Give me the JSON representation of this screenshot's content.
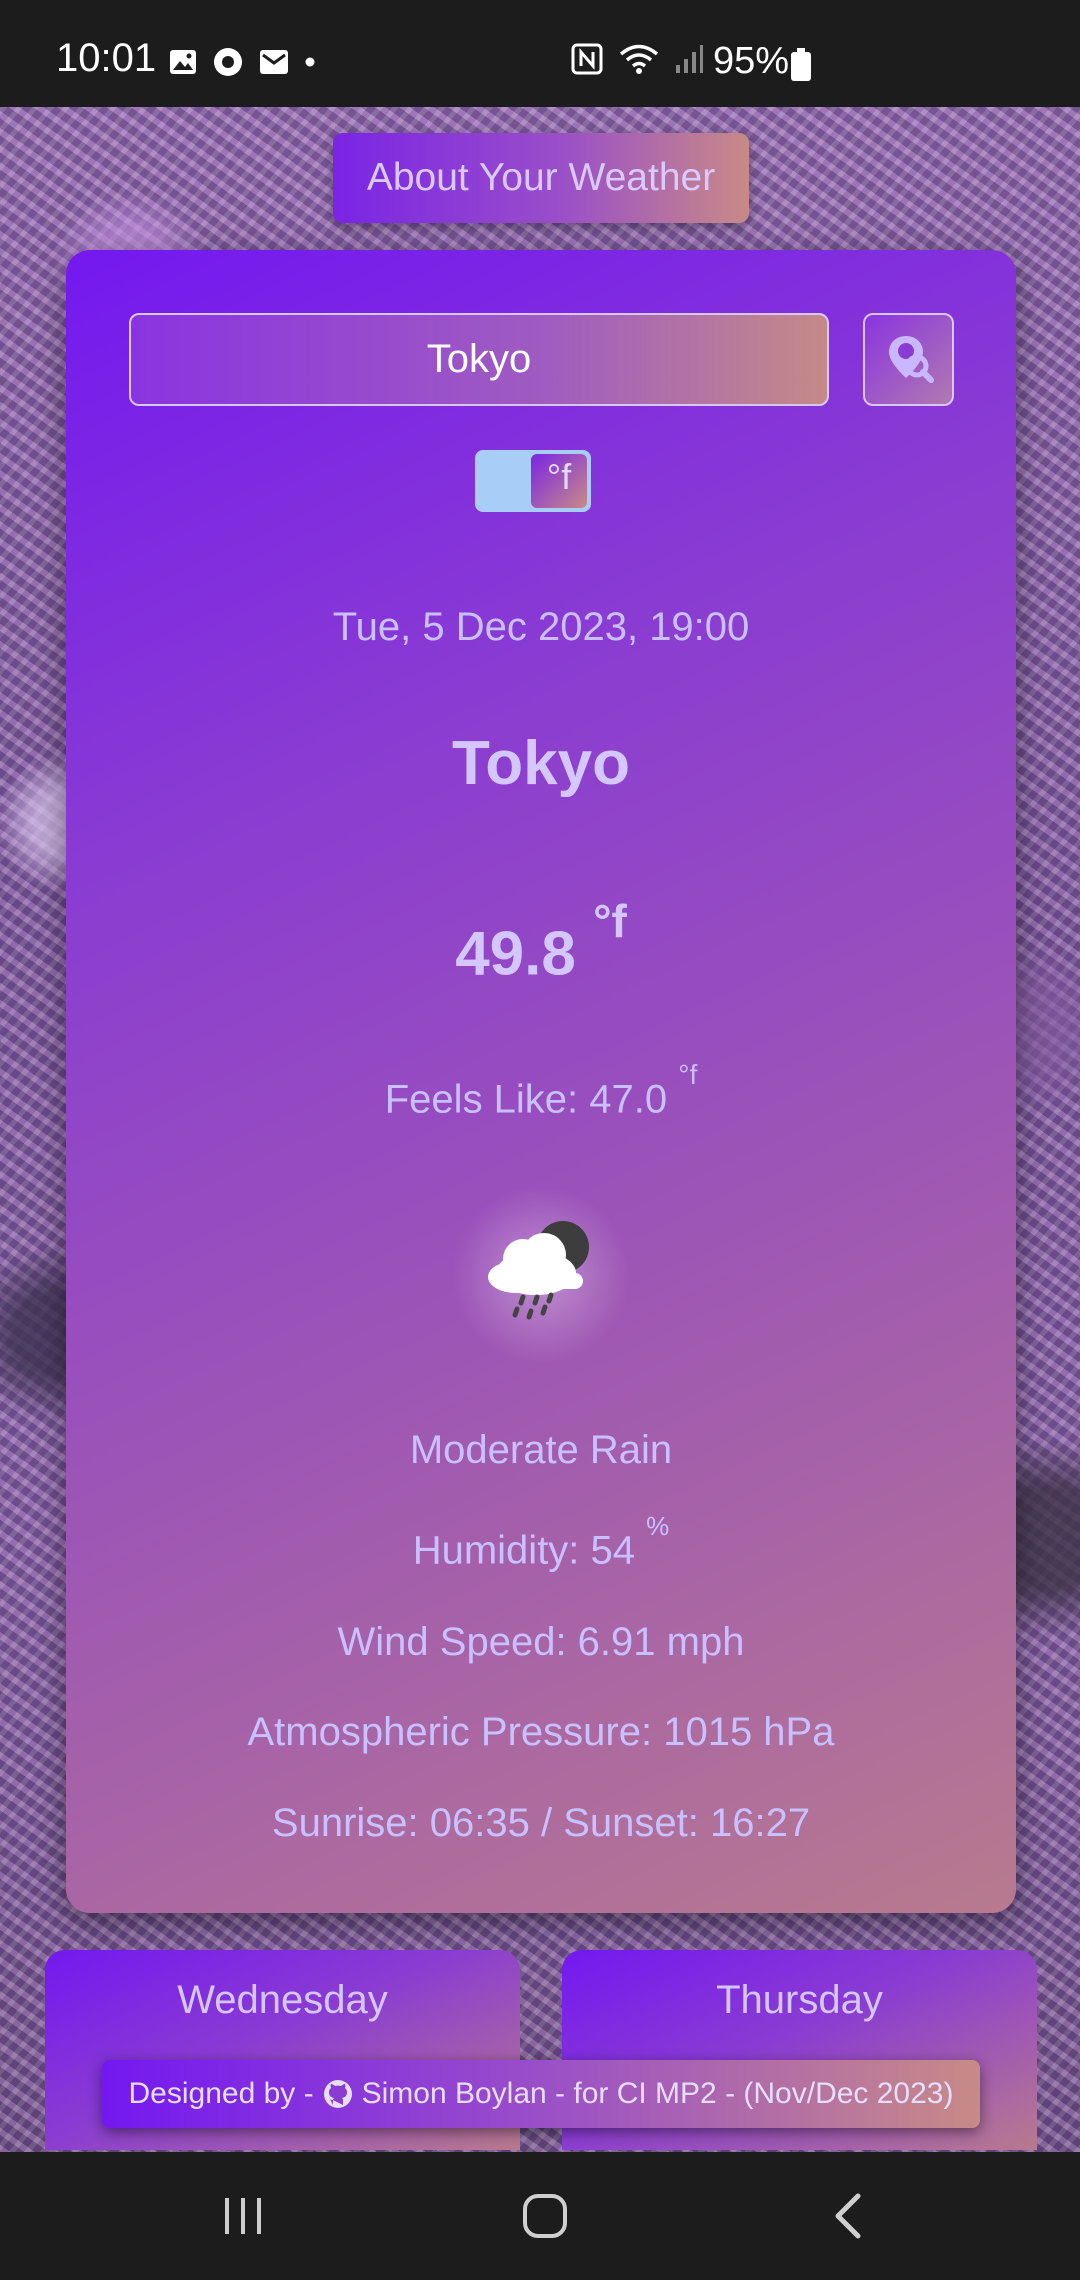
{
  "status_bar": {
    "time": "10:01",
    "battery": "95%",
    "icons_left": [
      "gallery-icon",
      "media-icon",
      "mail-icon",
      "dot-icon"
    ],
    "icons_right": [
      "nfc-icon",
      "wifi-icon",
      "signal-icon",
      "battery-icon"
    ]
  },
  "header": {
    "about_label": "About Your Weather"
  },
  "search": {
    "value": "Tokyo",
    "button_icon": "location-search-icon"
  },
  "unit_toggle": {
    "label": "°f"
  },
  "current": {
    "datetime": "Tue, 5 Dec 2023, 19:00",
    "city": "Tokyo",
    "temperature": "49.8",
    "temperature_unit": "°f",
    "feels_like_label": "Feels Like: 47.0",
    "feels_like_unit": "°f",
    "condition_icon": "night-rain-cloud-icon",
    "description": "Moderate Rain",
    "humidity_label": "Humidity: 54",
    "humidity_unit": "%",
    "wind": "Wind Speed: 6.91 mph",
    "pressure": "Atmospheric Pressure: 1015 hPa",
    "sun": "Sunrise: 06:35 / Sunset: 16:27"
  },
  "forecast": [
    {
      "day": "Wednesday"
    },
    {
      "day": "Thursday"
    }
  ],
  "footer": {
    "prefix": "Designed by -",
    "text": "Simon Boylan - for CI MP2 - (Nov/Dec 2023)",
    "icon": "github-icon"
  },
  "colors": {
    "accent_start": "#7418f0",
    "accent_end": "#c88a86",
    "text": "#c9c0ff",
    "toggle_track": "#a8cdf6"
  }
}
